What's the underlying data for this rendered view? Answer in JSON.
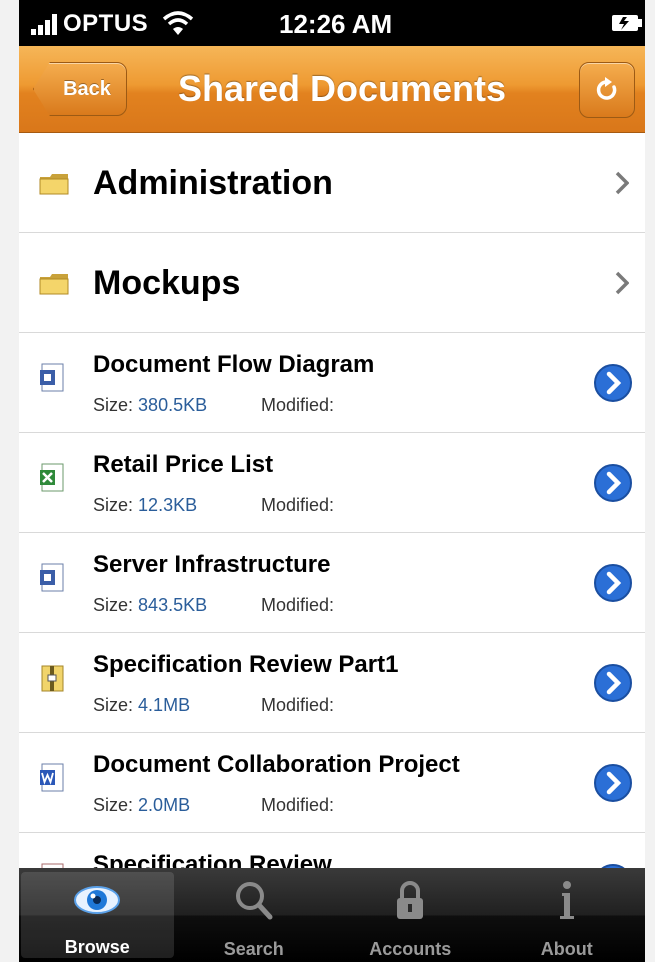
{
  "status_bar": {
    "carrier": "OPTUS",
    "time": "12:26 AM"
  },
  "nav": {
    "back_label": "Back",
    "title": "Shared Documents"
  },
  "folders": [
    {
      "name": "Administration"
    },
    {
      "name": "Mockups"
    }
  ],
  "files": [
    {
      "name": "Document Flow Diagram",
      "size_label": "Size:",
      "size": "380.5KB",
      "modified_label": "Modified:",
      "icon": "visio-file-icon"
    },
    {
      "name": "Retail Price List",
      "size_label": "Size:",
      "size": "12.3KB",
      "modified_label": "Modified:",
      "icon": "excel-file-icon"
    },
    {
      "name": "Server Infrastructure",
      "size_label": "Size:",
      "size": "843.5KB",
      "modified_label": "Modified:",
      "icon": "visio-file-icon"
    },
    {
      "name": "Specification Review Part1",
      "size_label": "Size:",
      "size": "4.1MB",
      "modified_label": "Modified:",
      "icon": "zip-file-icon"
    },
    {
      "name": "Document Collaboration Project",
      "size_label": "Size:",
      "size": "2.0MB",
      "modified_label": "Modified:",
      "icon": "word-file-icon"
    },
    {
      "name": "Specification Review",
      "size_label": "",
      "size": "",
      "modified_label": "",
      "icon": "pdf-file-icon"
    }
  ],
  "tabs": [
    {
      "label": "Browse",
      "icon": "eye-icon",
      "active": true
    },
    {
      "label": "Search",
      "icon": "magnifier-icon",
      "active": false
    },
    {
      "label": "Accounts",
      "icon": "lock-icon",
      "active": false
    },
    {
      "label": "About",
      "icon": "info-icon",
      "active": false
    }
  ],
  "colors": {
    "nav_orange": "#ee9a32",
    "link_blue": "#2a5d9a",
    "disclosure_blue": "#2b6fd6"
  }
}
